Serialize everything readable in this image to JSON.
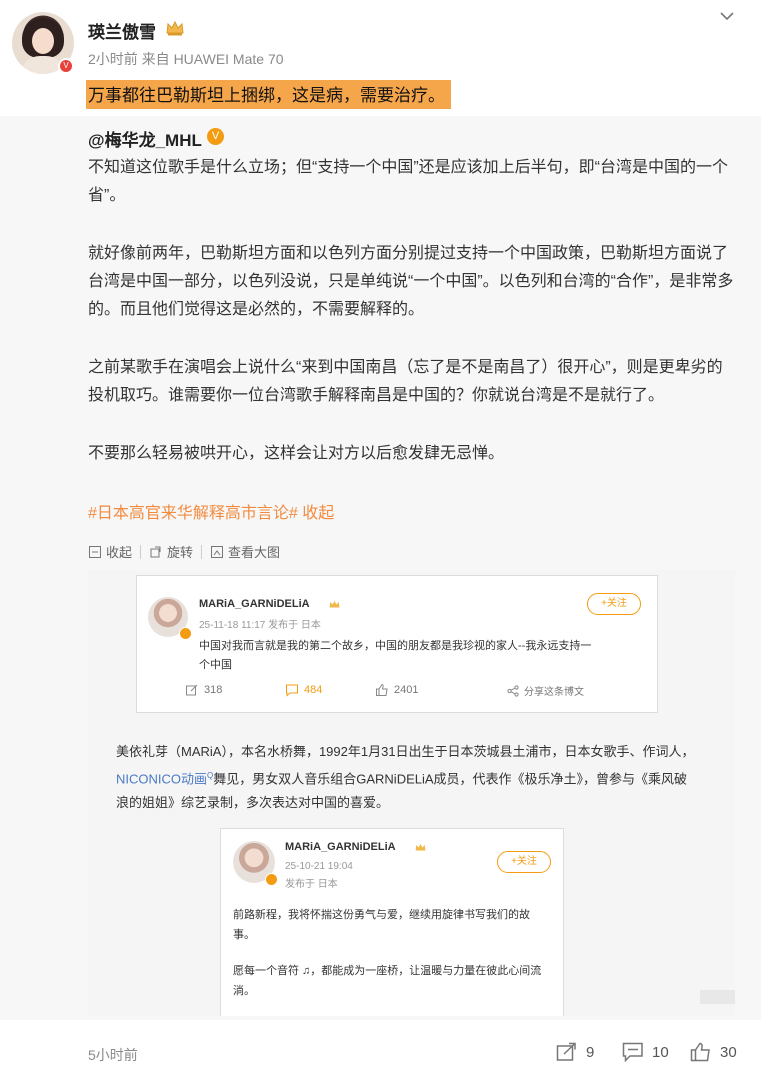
{
  "post": {
    "author": "瑛兰傲雪",
    "meta": "2小时前 来自 HUAWEI Mate 70",
    "text": "万事都往巴勒斯坦上捆绑，这是病，需要治疗。"
  },
  "retweet": {
    "author": "@梅华龙_MHL",
    "paragraphs": [
      "不知道这位歌手是什么立场；但“支持一个中国”还是应该加上后半句，即“台湾是中国的一个省”。",
      "就好像前两年，巴勒斯坦方面和以色列方面分别提过支持一个中国政策，巴勒斯坦方面说了台湾是中国一部分，以色列没说，只是单纯说“一个中国”。以色列和台湾的“合作”，是非常多的。而且他们觉得这是必然的，不需要解释的。",
      "之前某歌手在演唱会上说什么“来到中国南昌（忘了是不是南昌了）很开心”，则是更卑劣的投机取巧。谁需要你一位台湾歌手解释南昌是中国的？你就说台湾是不是就行了。",
      "不要那么轻易被哄开心，这样会让对方以后愈发肆无忌惮。"
    ],
    "hashtag": "#日本高官来华解释高市言论#",
    "collapse_label": "收起",
    "image_tools": [
      "收起",
      "旋转",
      "查看大图"
    ]
  },
  "embedded": {
    "card1": {
      "name": "MARiA_GARNiDELiA",
      "meta": "25-11-18 11:17 发布于 日本",
      "follow": "+关注",
      "text_line1": "中国对我而言就是我的第二个故乡，中国的朋友都是我珍视的家人--我永远支持一",
      "text_line2": "个中国",
      "repost": "318",
      "comment": "484",
      "like": "2401",
      "share": "分享这条博文"
    },
    "bio": {
      "part1": "美依礼芽（MARiA），本名水桥舞，1992年1月31日出生于日本茨城县土浦市，日本女歌手、作词人，",
      "link": "NICONICO动画",
      "part2": "舞见，男女双人音乐组合GARNiDELiA成员，代表作《极乐净土》，曾参与《乘风破浪的姐姐》综艺录制，多次表达对中国的喜爱。"
    },
    "card2": {
      "name": "MARiA_GARNiDELiA",
      "date": "25-10-21 19:04",
      "location": "发布于 日本",
      "follow": "+关注",
      "text1": "前路新程，我将怀揣这份勇气与爱，继续用旋律书写我们的故事。",
      "text2": "愿每一个音符 ♫，都能成为一座桥，让温暖与力量在彼此心间流淌。"
    }
  },
  "footer": {
    "time": "5小时前",
    "repost_count": "9",
    "comment_count": "10",
    "like_count": "30"
  },
  "colors": {
    "highlight": "#f5a54a",
    "hashtag": "#f28b3f",
    "retweet_bg": "#f7f7f7",
    "accent": "#f39c12"
  }
}
